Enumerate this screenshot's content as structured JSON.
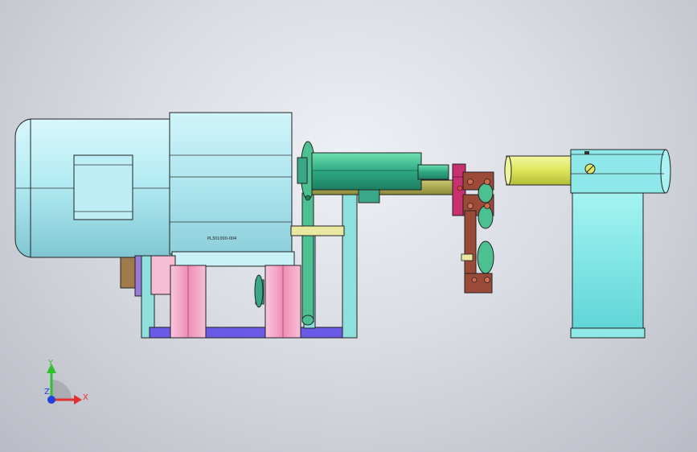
{
  "model": {
    "part_label": "PL301000-004"
  },
  "triad": {
    "x_label": "X",
    "y_label": "Y",
    "z_label": "Z"
  },
  "colors": {
    "motor_body": "#b4ecf4",
    "frame_cyan": "#8ee0dc",
    "pink_column": "#f2a8c4",
    "base_blue": "#6a5ae6",
    "shaft_green": "#36b88c",
    "pulley_green": "#4cc090",
    "gold_shaft": "#e8e8a0",
    "olive_rod": "#a8a850",
    "yellow_shaft": "#e0e860",
    "magenta_block": "#c83070",
    "brown_bracket": "#9c4a38",
    "rear_housing": "#7ee4e4"
  }
}
